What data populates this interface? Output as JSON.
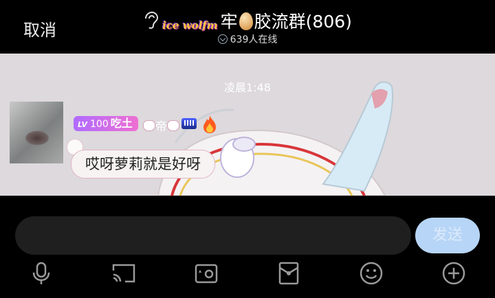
{
  "header": {
    "cancel_label": "取消",
    "logo_text": "ice wolfm",
    "title_part1": "牢",
    "title_part2": "胶流群(806)",
    "online_text": "639人在线"
  },
  "chat": {
    "timestamp": "凌晨1:48",
    "message": {
      "level_prefix": "LV",
      "level_number": "100",
      "title_badge": "吃土",
      "sender_name": "帝",
      "text": "哎呀萝莉就是好呀"
    }
  },
  "composer": {
    "input_value": "",
    "send_label": "发送"
  },
  "toolbar": {
    "icons": [
      "microphone-icon",
      "cast-icon",
      "photo-icon",
      "red-packet-icon",
      "emoji-icon",
      "plus-icon"
    ]
  },
  "colors": {
    "send_button": "#b7d5f6",
    "badge_gradient_start": "#b06bff",
    "badge_gradient_end": "#ee6fd2",
    "chat_background": "#ddd9dc"
  }
}
